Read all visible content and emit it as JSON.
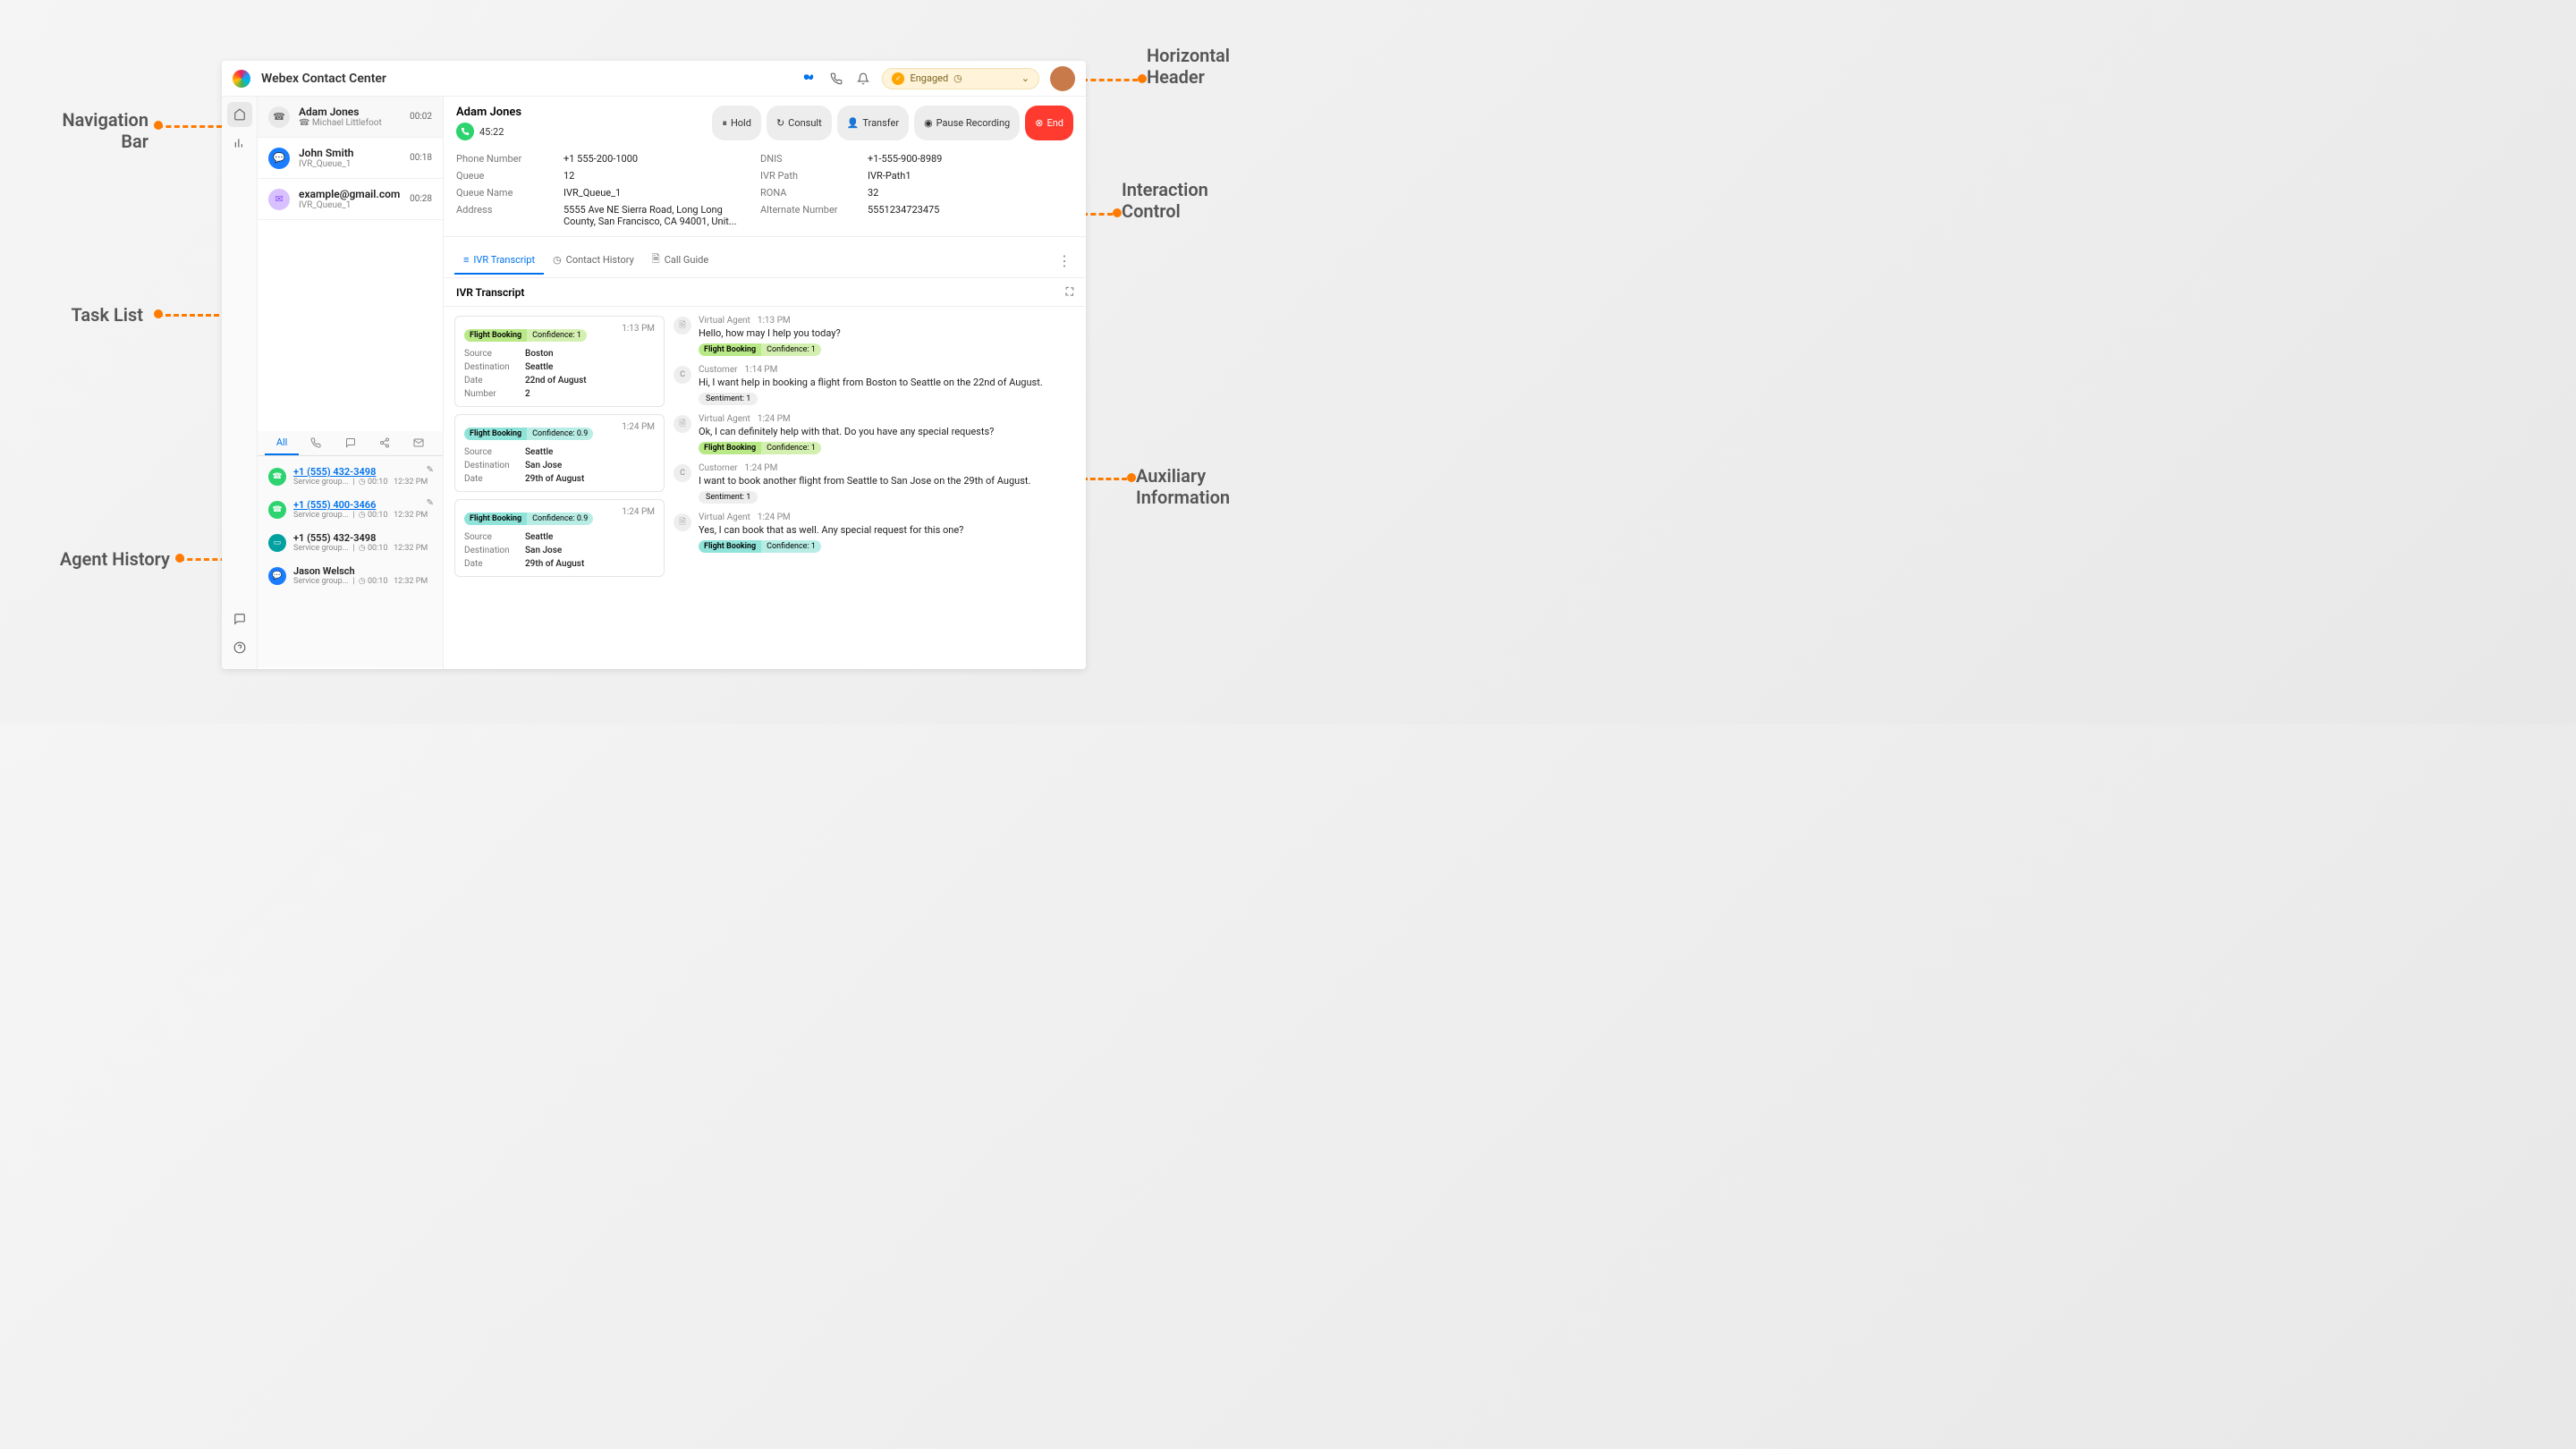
{
  "header": {
    "title": "Webex Contact Center",
    "status_label": "Engaged"
  },
  "tasks": [
    {
      "name": "Adam Jones",
      "sub": "Michael Littlefoot",
      "time": "00:02",
      "type": "call"
    },
    {
      "name": "John Smith",
      "sub": "IVR_Queue_1",
      "time": "00:18",
      "type": "chat"
    },
    {
      "name": "example@gmail.com",
      "sub": "IVR_Queue_1",
      "time": "00:28",
      "type": "email"
    }
  ],
  "interaction": {
    "name": "Adam Jones",
    "timer": "45:22",
    "actions": {
      "hold": "Hold",
      "consult": "Consult",
      "transfer": "Transfer",
      "pause": "Pause Recording",
      "end": "End"
    },
    "fields": {
      "phone_lbl": "Phone Number",
      "phone": "+1 555-200-1000",
      "dnis_lbl": "DNIS",
      "dnis": "+1-555-900-8989",
      "queue_lbl": "Queue",
      "queue": "12",
      "ivr_lbl": "IVR Path",
      "ivr": "IVR-Path1",
      "qname_lbl": "Queue Name",
      "qname": "IVR_Queue_1",
      "rona_lbl": "RONA",
      "rona": "32",
      "addr_lbl": "Address",
      "addr": "5555 Ave NE Sierra Road, Long Long County, San Francisco, CA 94001, Unit...",
      "alt_lbl": "Alternate Number",
      "alt": "5551234723475"
    }
  },
  "aux": {
    "tabs": {
      "ivr": "IVR Transcript",
      "history": "Contact History",
      "guide": "Call Guide"
    },
    "panel_title": "IVR Transcript"
  },
  "tr_left": [
    {
      "time": "1:13 PM",
      "badge": "green",
      "intent": "Flight Booking",
      "conf": "Confidence: 1",
      "kv": [
        [
          "Source",
          "Boston"
        ],
        [
          "Destination",
          "Seattle"
        ],
        [
          "Date",
          "22nd of August"
        ],
        [
          "Number",
          "2"
        ]
      ]
    },
    {
      "time": "1:24 PM",
      "badge": "teal",
      "intent": "Flight Booking",
      "conf": "Confidence: 0.9",
      "kv": [
        [
          "Source",
          "Seattle"
        ],
        [
          "Destination",
          "San Jose"
        ],
        [
          "Date",
          "29th of August"
        ]
      ]
    },
    {
      "time": "1:24 PM",
      "badge": "teal",
      "intent": "Flight Booking",
      "conf": "Confidence: 0.9",
      "kv": [
        [
          "Source",
          "Seattle"
        ],
        [
          "Destination",
          "San Jose"
        ],
        [
          "Date",
          "29th of August"
        ]
      ]
    }
  ],
  "tr_right": [
    {
      "who": "Virtual Agent",
      "time": "1:13 PM",
      "ava": "bot",
      "text": "Hello, how may I help you today?",
      "tag": {
        "cls": "green",
        "a": "Flight Booking",
        "b": "Confidence: 1"
      }
    },
    {
      "who": "Customer",
      "time": "1:14 PM",
      "ava": "C",
      "text": "Hi, I want help in booking a flight from Boston to Seattle on the 22nd of August.",
      "sent": "Sentiment: 1"
    },
    {
      "who": "Virtual Agent",
      "time": "1:24 PM",
      "ava": "bot",
      "text": "Ok, I can definitely help with that. Do you have any special requests?",
      "tag": {
        "cls": "green",
        "a": "Flight Booking",
        "b": "Confidence: 1"
      }
    },
    {
      "who": "Customer",
      "time": "1:24 PM",
      "ava": "C",
      "text": "I want to book another flight from Seattle to San Jose on the 29th of August.",
      "sent": "Sentiment: 1"
    },
    {
      "who": "Virtual Agent",
      "time": "1:24 PM",
      "ava": "bot",
      "text": "Yes, I can book that as well. Any special request for this one?",
      "tag": {
        "cls": "teal",
        "a": "Flight Booking",
        "b": "Confidence: 1"
      }
    }
  ],
  "history": {
    "tabs": {
      "all": "All"
    },
    "items": [
      {
        "ico": "grn",
        "num": "+1 (555) 432-3498",
        "link": true,
        "sub": "Service group...",
        "dur": "00:10",
        "time": "12:32 PM",
        "edit": true
      },
      {
        "ico": "grn",
        "num": "+1 (555) 400-3466",
        "link": true,
        "sub": "Service group...",
        "dur": "00:10",
        "time": "12:32 PM",
        "edit": true
      },
      {
        "ico": "teal",
        "num": "+1 (555) 432-3498",
        "link": false,
        "sub": "Service group...",
        "dur": "00:10",
        "time": "12:32 PM",
        "edit": false
      },
      {
        "ico": "blu",
        "num": "Jason Welsch",
        "link": false,
        "sub": "Service group...",
        "dur": "00:10",
        "time": "12:32 PM",
        "edit": false
      }
    ]
  },
  "annotations": {
    "nav": "Navigation\nBar",
    "task": "Task List",
    "hist": "Agent History",
    "hdr": "Horizontal\nHeader",
    "int": "Interaction\nControl",
    "aux": "Auxiliary\nInformation"
  }
}
